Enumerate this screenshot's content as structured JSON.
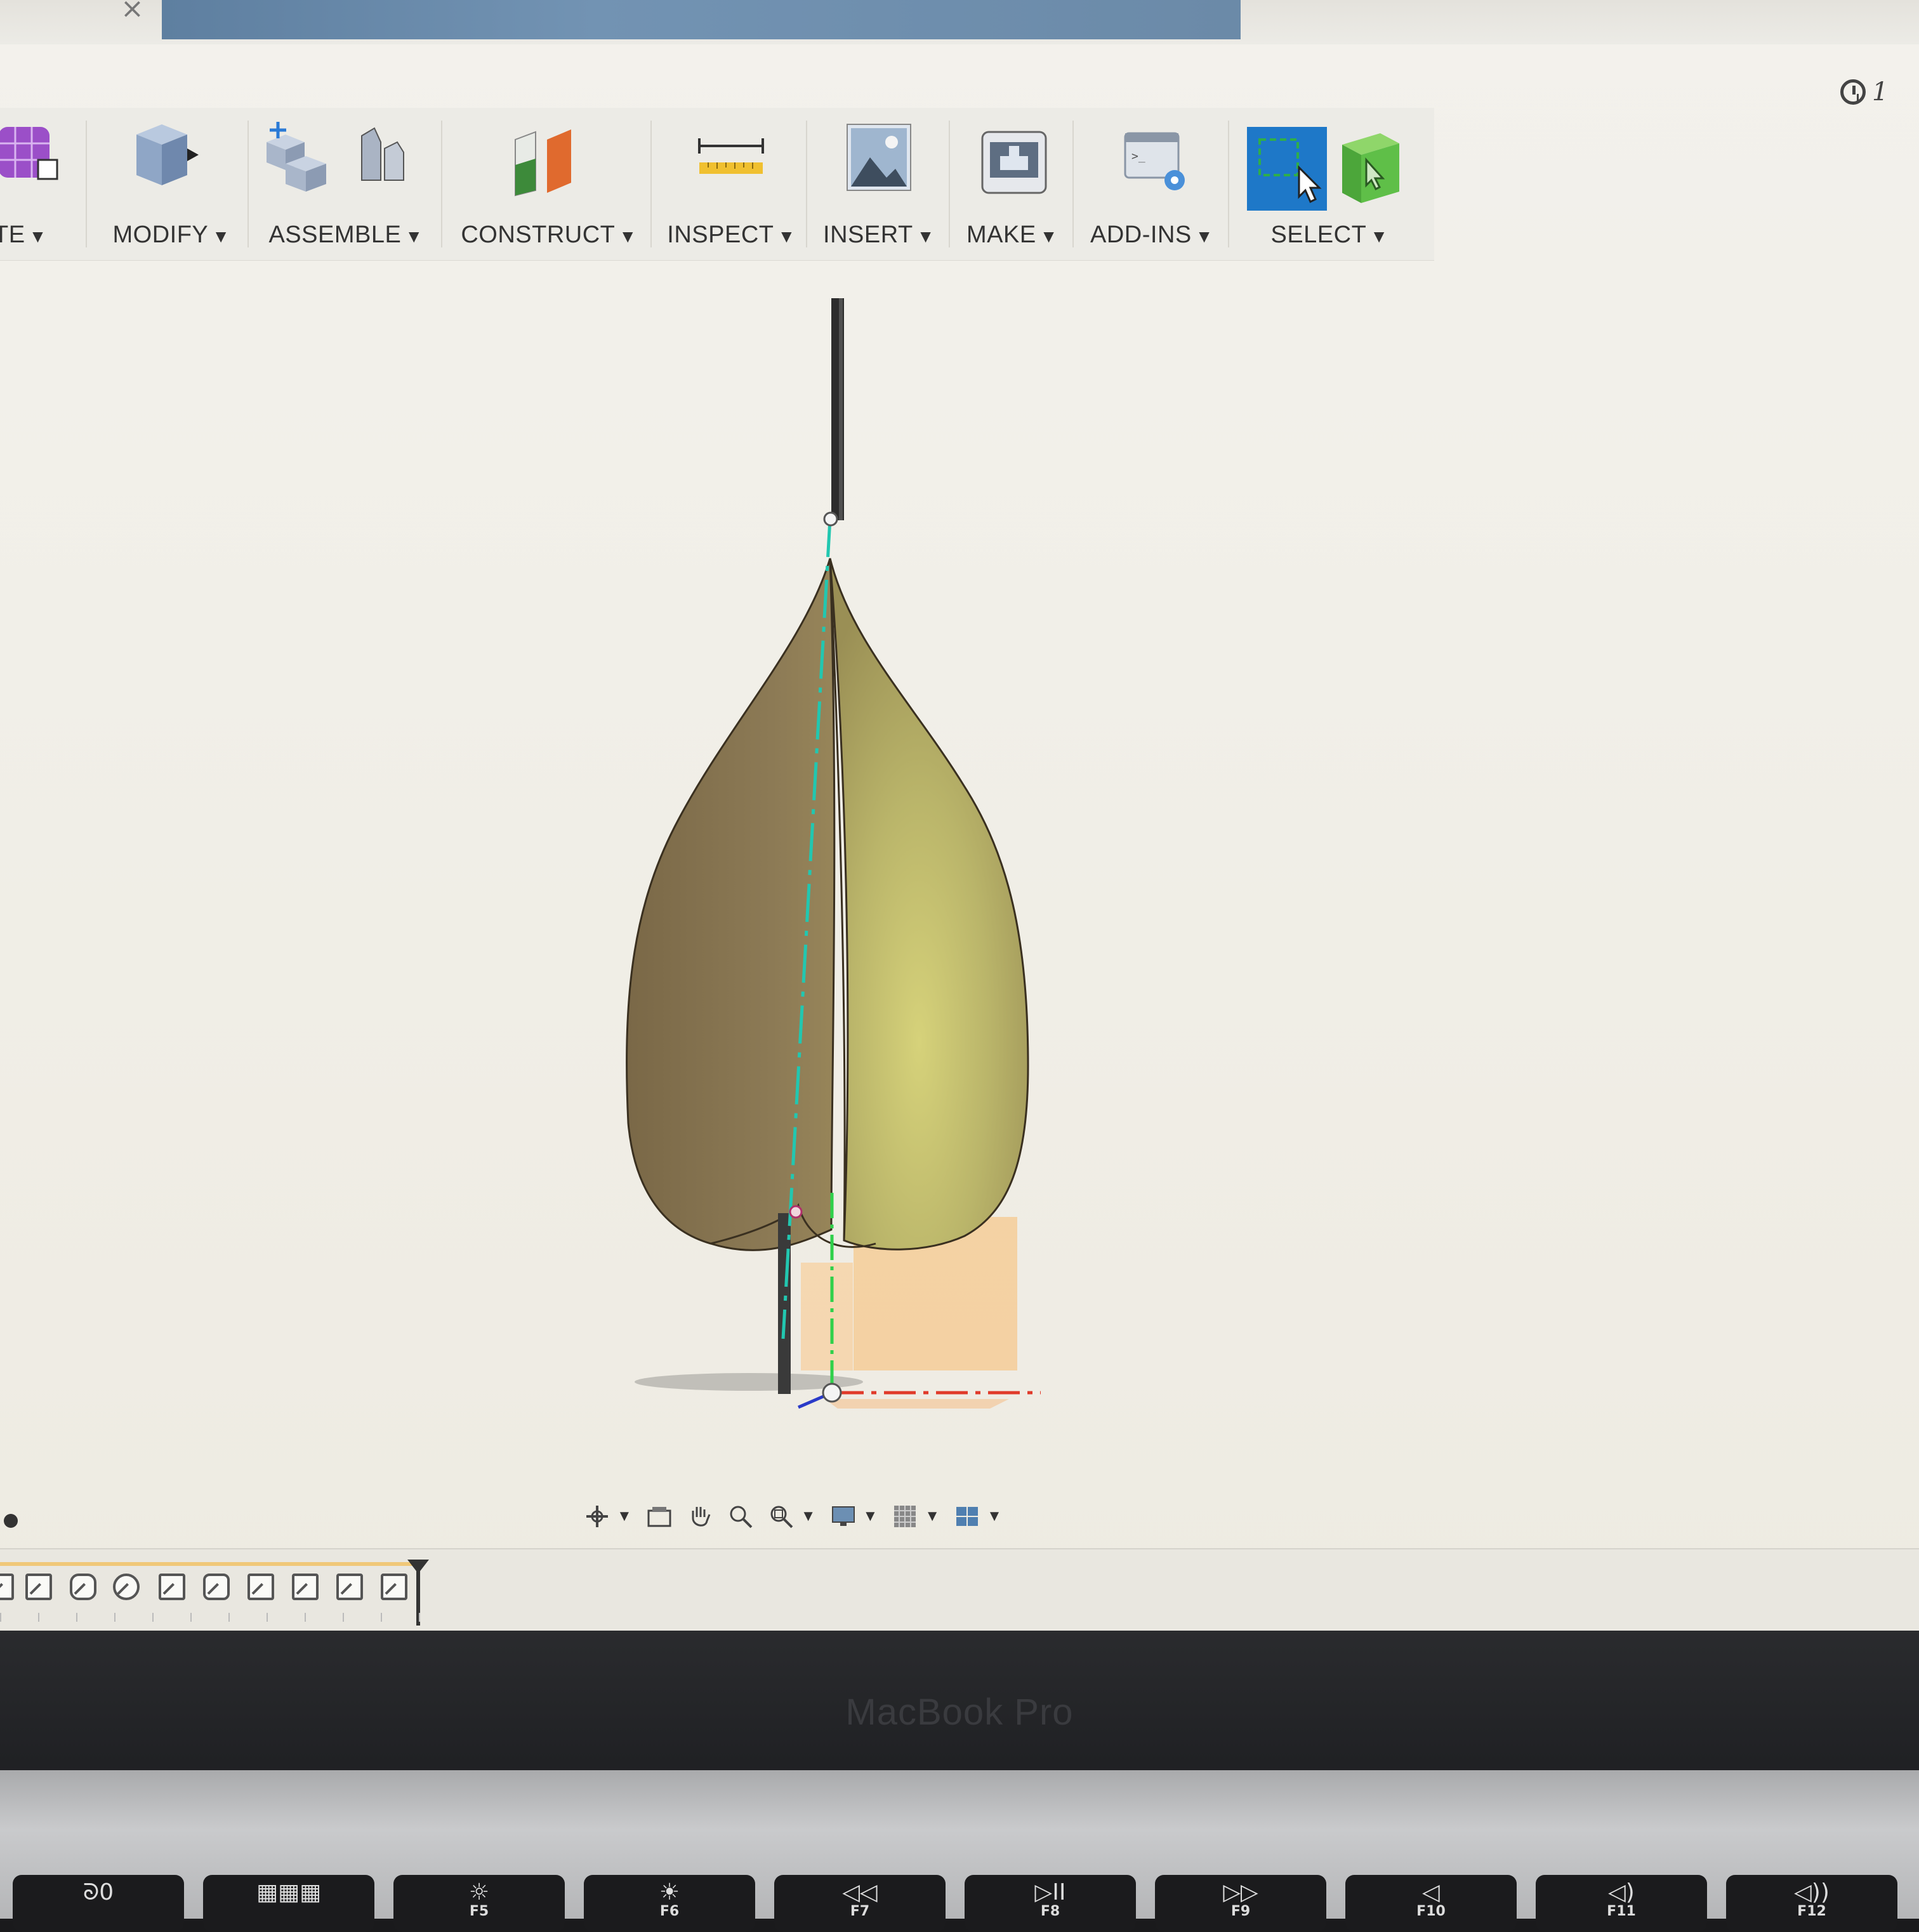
{
  "window": {
    "close_glyph": "×",
    "history_count": "1"
  },
  "toolbar": {
    "groups": [
      {
        "label": "TE",
        "icon": "form-cube-icon"
      },
      {
        "label": "MODIFY",
        "icon": "press-pull-cube-icon"
      },
      {
        "label": "ASSEMBLE",
        "icon": "new-component-icon"
      },
      {
        "label": "CONSTRUCT",
        "icon": "offset-plane-icon"
      },
      {
        "label": "INSPECT",
        "icon": "measure-icon"
      },
      {
        "label": "INSERT",
        "icon": "insert-image-icon"
      },
      {
        "label": "MAKE",
        "icon": "3d-print-icon"
      },
      {
        "label": "ADD-INS",
        "icon": "scripts-icon"
      },
      {
        "label": "SELECT",
        "icon": "select-icon"
      }
    ],
    "dropdown_caret": "▼"
  },
  "model": {
    "name": "teardrop-body",
    "colors": {
      "body_left": "#8a7752",
      "body_right": "#b8b26a",
      "axis_cyan": "#22c7b0",
      "axis_green": "#2fd04a",
      "axis_red": "#e03a2a",
      "axis_blue": "#2a3ac8",
      "plane_orange": "#f5c890"
    }
  },
  "navigation": {
    "tools": [
      "orbit-icon",
      "look-at-icon",
      "pan-icon",
      "zoom-icon",
      "zoom-window-icon",
      "display-settings-icon",
      "grid-settings-icon",
      "viewports-icon"
    ]
  },
  "timeline": {
    "steps": 10
  },
  "laptop": {
    "brand": "MacBook Pro",
    "keys": [
      {
        "glyph": "ᘐ0",
        "fk": ""
      },
      {
        "glyph": "▦▦▦",
        "fk": ""
      },
      {
        "glyph": "☼",
        "fk": "F5"
      },
      {
        "glyph": "☀",
        "fk": "F6"
      },
      {
        "glyph": "◁◁",
        "fk": "F7"
      },
      {
        "glyph": "▷II",
        "fk": "F8"
      },
      {
        "glyph": "▷▷",
        "fk": "F9"
      },
      {
        "glyph": "◁",
        "fk": "F10"
      },
      {
        "glyph": "◁)",
        "fk": "F11"
      },
      {
        "glyph": "◁))",
        "fk": "F12"
      }
    ]
  }
}
